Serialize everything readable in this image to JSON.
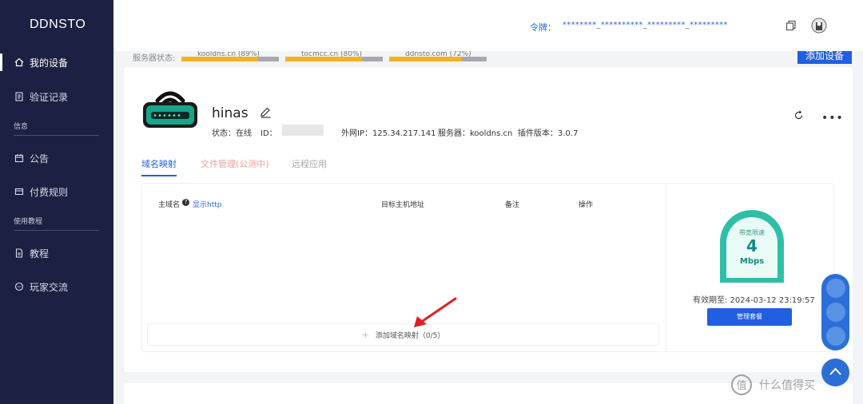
{
  "sidebar": {
    "brand": "DDNSTO",
    "items": [
      {
        "label": "我的设备",
        "icon": "home-icon",
        "active": true
      },
      {
        "label": "验证记录",
        "icon": "document-icon",
        "active": false
      }
    ],
    "section_info": "信息",
    "info_items": [
      {
        "label": "公告",
        "icon": "calendar-icon"
      },
      {
        "label": "付费规则",
        "icon": "card-icon"
      }
    ],
    "section_guide": "使用教程",
    "guide_items": [
      {
        "label": "教程",
        "icon": "file-icon"
      },
      {
        "label": "玩家交流",
        "icon": "chat-icon"
      }
    ]
  },
  "topbar": {
    "token_label": "令牌：",
    "token_value": "********_**********_*********_*********"
  },
  "server_strip": {
    "label": "服务器状态:",
    "servers": [
      {
        "name": "kooldns.cn (89%)",
        "load": 0.89
      },
      {
        "name": "tocmcc.cn (80%)",
        "load": 0.8
      },
      {
        "name": "ddnsto.com (72%)",
        "load": 0.72
      }
    ],
    "add_device_label": "添加设备"
  },
  "device": {
    "name": "hinas",
    "status": "状态：在线",
    "id_label": "ID：",
    "public_ip": "外网IP：125.34.217.141",
    "server": "服务器：kooldns.cn",
    "plugin_version": "插件版本：3.0.7"
  },
  "tabs": [
    {
      "label": "域名映射",
      "state": "active"
    },
    {
      "label": "文件管理(公测中)",
      "state": "warn"
    },
    {
      "label": "远程应用",
      "state": "muted"
    }
  ],
  "table": {
    "headers": {
      "host": "主域名",
      "help": "?",
      "show_http": "显示http",
      "target": "目标主机地址",
      "remark": "备注",
      "action": "操作"
    },
    "add_row": "添加域名映射（0/5）"
  },
  "plan": {
    "gauge_title": "带宽限速",
    "gauge_value": "4",
    "gauge_unit": "Mbps",
    "expiry": "有效期至: 2024-03-12 23:19:57",
    "manage_label": "管理套餐"
  },
  "watermark": {
    "text": "什么值得买",
    "logo_char": "值"
  },
  "colors": {
    "sidebar_bg": "#1c2143",
    "primary": "#1f5fe0",
    "gauge": "#2fbfa8",
    "arrow": "#e02020"
  }
}
